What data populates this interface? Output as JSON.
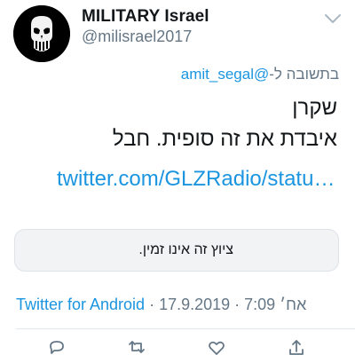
{
  "author": {
    "display_name": "MILITARY Israel",
    "handle": "@milisrael2017",
    "avatar_icon": "punisher-skull-icon"
  },
  "reply": {
    "prefix": "בתשובה ל-",
    "handle": "@amit_segal"
  },
  "tweet": {
    "line1": "שקרן",
    "line2": "איבדת את זה סופית. חבל",
    "link": "twitter.com/GLZRadio/statu…"
  },
  "notice": {
    "text": "ציוץ זה אינו זמין."
  },
  "meta": {
    "app": "Twitter for Android",
    "separator": " · ",
    "date": "17.9.2019 · 7:09 אח׳"
  },
  "colors": {
    "link": "#1b95e0",
    "secondary_text": "#657786",
    "notice_bg": "#f1f3f5"
  },
  "actions": [
    "reply-icon",
    "retweet-icon",
    "like-icon",
    "share-icon"
  ]
}
